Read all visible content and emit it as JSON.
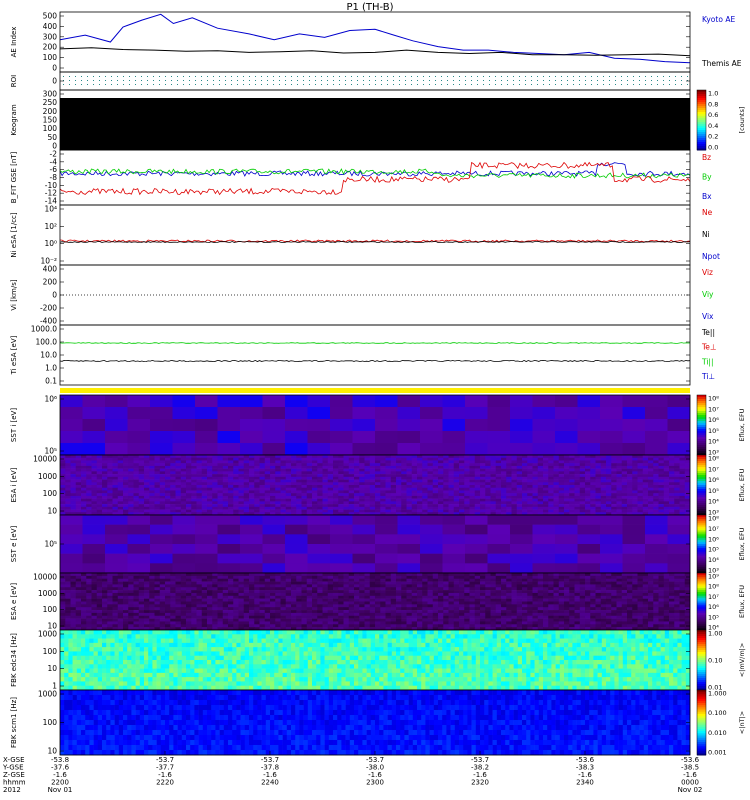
{
  "title": "P1 (TH-B)",
  "colors": {
    "blue": "#0000cc",
    "black": "#000000",
    "red": "#dd0000",
    "green": "#00cc00",
    "yellow": "#ffee00"
  },
  "chart_data": [
    {
      "id": "ae",
      "type": "line",
      "ylabel": "AE Index",
      "yticks": [
        "500",
        "400",
        "300",
        "200",
        "100",
        "0"
      ],
      "ylim": [
        0,
        520
      ],
      "series": [
        {
          "name": "Kyoto AE",
          "color": "#0000cc",
          "x": [
            0,
            0.04,
            0.08,
            0.1,
            0.13,
            0.16,
            0.18,
            0.21,
            0.25,
            0.3,
            0.34,
            0.38,
            0.42,
            0.46,
            0.5,
            0.53,
            0.56,
            0.6,
            0.64,
            0.68,
            0.72,
            0.76,
            0.8,
            0.84,
            0.88,
            0.92,
            0.96,
            1.0
          ],
          "y": [
            280,
            320,
            260,
            390,
            450,
            500,
            420,
            470,
            380,
            330,
            280,
            330,
            300,
            360,
            370,
            320,
            270,
            220,
            190,
            190,
            170,
            160,
            150,
            170,
            120,
            110,
            90,
            80
          ]
        },
        {
          "name": "Themis AE",
          "color": "#000000",
          "x": [
            0,
            0.05,
            0.1,
            0.15,
            0.2,
            0.25,
            0.3,
            0.35,
            0.4,
            0.45,
            0.5,
            0.55,
            0.6,
            0.65,
            0.7,
            0.75,
            0.8,
            0.85,
            0.9,
            0.95,
            1.0
          ],
          "y": [
            200,
            210,
            195,
            190,
            180,
            185,
            170,
            175,
            185,
            165,
            170,
            190,
            170,
            160,
            170,
            150,
            150,
            145,
            150,
            155,
            140
          ]
        }
      ]
    },
    {
      "id": "roi",
      "type": "line",
      "ylabel": "ROI",
      "yticks": [
        "0"
      ]
    },
    {
      "id": "keogram",
      "type": "heatmap",
      "ylabel": "Keogram",
      "yticks": [
        "300",
        "250",
        "200",
        "150",
        "100",
        "50",
        "0"
      ],
      "colorbar": {
        "label": "[counts]",
        "ticks": [
          "1.0",
          "0.8",
          "0.6",
          "0.4",
          "0.2",
          "0.0"
        ]
      }
    },
    {
      "id": "bfgm",
      "type": "line",
      "ylabel": "B_FIT GSE [nT]",
      "yticks": [
        "-2",
        "-4",
        "-6",
        "-8",
        "-10",
        "-12",
        "-14"
      ],
      "ylim": [
        -14,
        -2
      ],
      "series": [
        {
          "name": "Bz",
          "color": "#dd0000"
        },
        {
          "name": "By",
          "color": "#00cc00"
        },
        {
          "name": "Bx",
          "color": "#0000cc"
        }
      ]
    },
    {
      "id": "ni",
      "type": "line",
      "ylabel": "Ni eSA [1/cc]",
      "yticks": [
        "10⁴",
        "10²",
        "10⁰",
        "10⁻²"
      ],
      "series": [
        {
          "name": "Ne",
          "color": "#dd0000"
        },
        {
          "name": "Ni",
          "color": "#000000"
        },
        {
          "name": "Npot",
          "color": "#0000cc"
        }
      ]
    },
    {
      "id": "vi",
      "type": "line",
      "ylabel": "Vi [km/s]",
      "yticks": [
        "400",
        "200",
        "0",
        "-200",
        "-400"
      ],
      "series": [
        {
          "name": "Viz",
          "color": "#dd0000"
        },
        {
          "name": "Viy",
          "color": "#00cc00"
        },
        {
          "name": "Vix",
          "color": "#0000cc"
        }
      ]
    },
    {
      "id": "ti",
      "type": "line",
      "ylabel": "Ti eSA [eV]",
      "yticks": [
        "1000.0",
        "100.0",
        "10.0",
        "1.0",
        "0.1"
      ],
      "series": [
        {
          "name": "Te||",
          "color": "#000000"
        },
        {
          "name": "Te⊥",
          "color": "#dd0000"
        },
        {
          "name": "Ti||",
          "color": "#00cc00"
        },
        {
          "name": "Ti⊥",
          "color": "#0000cc"
        }
      ]
    },
    {
      "id": "sst_i",
      "type": "heatmap",
      "ylabel": "SST i [eV]",
      "yticks": [
        "10⁶",
        "10⁵"
      ],
      "colorbar": {
        "label": "Eflux, EFU",
        "ticks": [
          "10⁸",
          "10⁷",
          "10⁶",
          "10⁵",
          "10⁴",
          "10³"
        ]
      }
    },
    {
      "id": "esa_i",
      "type": "heatmap",
      "ylabel": "ESA i [eV]",
      "yticks": [
        "10000",
        "1000",
        "100",
        "10"
      ],
      "colorbar": {
        "label": "Eflux, EFU",
        "ticks": [
          "10⁸",
          "10⁷",
          "10⁶",
          "10⁵",
          "10⁴",
          "10³"
        ]
      }
    },
    {
      "id": "sst_e",
      "type": "heatmap",
      "ylabel": "SST e [eV]",
      "yticks": [
        "10⁵"
      ],
      "colorbar": {
        "label": "Eflux, EFU",
        "ticks": [
          "10⁸",
          "10⁷",
          "10⁶",
          "10⁵",
          "10⁴",
          "10³"
        ]
      }
    },
    {
      "id": "esa_e",
      "type": "heatmap",
      "ylabel": "ESA e [eV]",
      "yticks": [
        "10000",
        "1000",
        "100",
        "10"
      ],
      "colorbar": {
        "label": "Eflux, EFU",
        "ticks": [
          "10⁹",
          "10⁸",
          "10⁷",
          "10⁶",
          "10⁵",
          "10⁴"
        ]
      }
    },
    {
      "id": "fbk_edc",
      "type": "heatmap",
      "ylabel": "FBK edc34 [Hz]",
      "yticks": [
        "1000",
        "100",
        "10",
        "1"
      ],
      "colorbar": {
        "label": "<|mV/m|>",
        "ticks": [
          "1.00",
          "0.10",
          "0.01"
        ]
      }
    },
    {
      "id": "fbk_scm",
      "type": "heatmap",
      "ylabel": "FBK scm1 [Hz]",
      "yticks": [
        "1000",
        "100",
        "10"
      ],
      "colorbar": {
        "label": "<|nT|>",
        "ticks": [
          "1.000",
          "0.100",
          "0.010",
          "0.001"
        ]
      }
    }
  ],
  "x_axis": {
    "row_labels": [
      "X-GSE",
      "Y-GSE",
      "Z-GSE",
      "hhmm",
      "2012"
    ],
    "ticks": [
      {
        "x": 0.0,
        "lines": [
          "-53.8",
          "-37.6",
          "-1.6",
          "2200",
          "Nov 01"
        ]
      },
      {
        "x": 0.1667,
        "lines": [
          "-53.7",
          "-37.7",
          "-1.6",
          "2220",
          ""
        ]
      },
      {
        "x": 0.3333,
        "lines": [
          "-53.7",
          "-37.8",
          "-1.6",
          "2240",
          ""
        ]
      },
      {
        "x": 0.5,
        "lines": [
          "-53.7",
          "-38.0",
          "-1.6",
          "2300",
          ""
        ]
      },
      {
        "x": 0.6667,
        "lines": [
          "-53.7",
          "-38.2",
          "-1.6",
          "2320",
          ""
        ]
      },
      {
        "x": 0.8333,
        "lines": [
          "-53.6",
          "-38.3",
          "-1.6",
          "2340",
          ""
        ]
      },
      {
        "x": 1.0,
        "lines": [
          "-53.6",
          "-38.5",
          "-1.6",
          "0000",
          "Nov 02"
        ]
      }
    ]
  }
}
